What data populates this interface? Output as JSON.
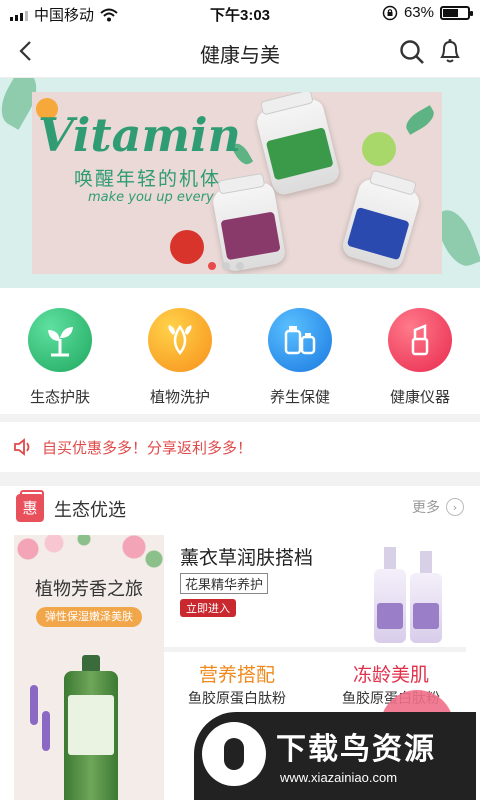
{
  "status_bar": {
    "carrier": "中国移动",
    "time": "下午3:03",
    "battery": "63%",
    "battery_level": 0.63
  },
  "header": {
    "title": "健康与美"
  },
  "banner": {
    "headline": "Vitamin",
    "slogan_cn": "唤醒年轻的机体",
    "slogan_en": "make you up everyday",
    "slide_count": 3,
    "active_slide": 0
  },
  "categories": [
    {
      "label": "生态护肤",
      "icon": "sprout-icon",
      "color": "#2fc17a"
    },
    {
      "label": "植物洗护",
      "icon": "leaf-drop-icon",
      "color": "#f7a21c"
    },
    {
      "label": "养生保健",
      "icon": "bottles-icon",
      "color": "#2a8ff0"
    },
    {
      "label": "健康仪器",
      "icon": "lipstick-icon",
      "color": "#f04466"
    }
  ],
  "notice": {
    "text": "自买优惠多多！分享返利多多！",
    "icon": "speaker-icon"
  },
  "section": {
    "badge": "惠",
    "title": "生态优选",
    "more": "更多",
    "left_card": {
      "title": "植物芳香之旅",
      "tag": "弹性保湿嫩泽美肤"
    },
    "top_card": {
      "title": "薰衣草润肤搭档",
      "subtitle": "花果精华养护",
      "button": "立即进入"
    },
    "bottom_cards": [
      {
        "title": "营养搭配",
        "subtitle": "鱼胶原蛋白肽粉",
        "color": "#f08a1f"
      },
      {
        "title": "冻龄美肌",
        "subtitle": "鱼胶原蛋白肽粉",
        "color": "#e0304a"
      }
    ]
  },
  "watermark": {
    "text": "下载鸟资源",
    "url": "www.xiazainiao.com"
  }
}
